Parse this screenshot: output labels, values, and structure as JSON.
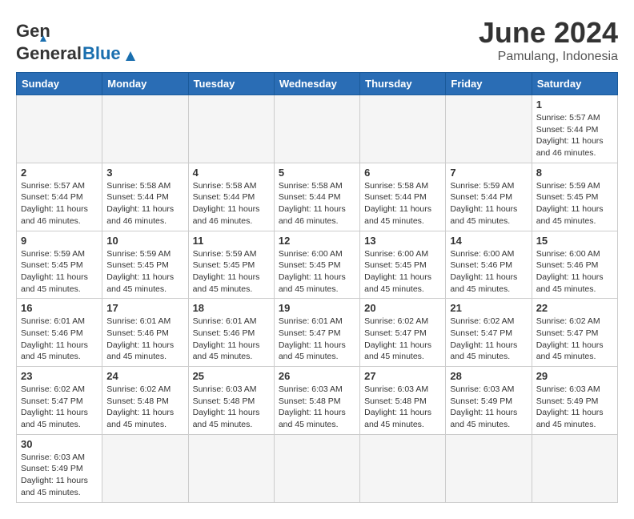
{
  "header": {
    "logo_general": "General",
    "logo_blue": "Blue",
    "month_year": "June 2024",
    "location": "Pamulang, Indonesia"
  },
  "weekdays": [
    "Sunday",
    "Monday",
    "Tuesday",
    "Wednesday",
    "Thursday",
    "Friday",
    "Saturday"
  ],
  "days": [
    {
      "date": "",
      "empty": true
    },
    {
      "date": "",
      "empty": true
    },
    {
      "date": "",
      "empty": true
    },
    {
      "date": "",
      "empty": true
    },
    {
      "date": "",
      "empty": true
    },
    {
      "date": "",
      "empty": true
    },
    {
      "date": "1",
      "sunrise": "5:57 AM",
      "sunset": "5:44 PM",
      "daylight": "11 hours and 46 minutes."
    },
    {
      "date": "2",
      "sunrise": "5:57 AM",
      "sunset": "5:44 PM",
      "daylight": "11 hours and 46 minutes."
    },
    {
      "date": "3",
      "sunrise": "5:58 AM",
      "sunset": "5:44 PM",
      "daylight": "11 hours and 46 minutes."
    },
    {
      "date": "4",
      "sunrise": "5:58 AM",
      "sunset": "5:44 PM",
      "daylight": "11 hours and 46 minutes."
    },
    {
      "date": "5",
      "sunrise": "5:58 AM",
      "sunset": "5:44 PM",
      "daylight": "11 hours and 46 minutes."
    },
    {
      "date": "6",
      "sunrise": "5:58 AM",
      "sunset": "5:44 PM",
      "daylight": "11 hours and 45 minutes."
    },
    {
      "date": "7",
      "sunrise": "5:59 AM",
      "sunset": "5:44 PM",
      "daylight": "11 hours and 45 minutes."
    },
    {
      "date": "8",
      "sunrise": "5:59 AM",
      "sunset": "5:45 PM",
      "daylight": "11 hours and 45 minutes."
    },
    {
      "date": "9",
      "sunrise": "5:59 AM",
      "sunset": "5:45 PM",
      "daylight": "11 hours and 45 minutes."
    },
    {
      "date": "10",
      "sunrise": "5:59 AM",
      "sunset": "5:45 PM",
      "daylight": "11 hours and 45 minutes."
    },
    {
      "date": "11",
      "sunrise": "5:59 AM",
      "sunset": "5:45 PM",
      "daylight": "11 hours and 45 minutes."
    },
    {
      "date": "12",
      "sunrise": "6:00 AM",
      "sunset": "5:45 PM",
      "daylight": "11 hours and 45 minutes."
    },
    {
      "date": "13",
      "sunrise": "6:00 AM",
      "sunset": "5:45 PM",
      "daylight": "11 hours and 45 minutes."
    },
    {
      "date": "14",
      "sunrise": "6:00 AM",
      "sunset": "5:46 PM",
      "daylight": "11 hours and 45 minutes."
    },
    {
      "date": "15",
      "sunrise": "6:00 AM",
      "sunset": "5:46 PM",
      "daylight": "11 hours and 45 minutes."
    },
    {
      "date": "16",
      "sunrise": "6:01 AM",
      "sunset": "5:46 PM",
      "daylight": "11 hours and 45 minutes."
    },
    {
      "date": "17",
      "sunrise": "6:01 AM",
      "sunset": "5:46 PM",
      "daylight": "11 hours and 45 minutes."
    },
    {
      "date": "18",
      "sunrise": "6:01 AM",
      "sunset": "5:46 PM",
      "daylight": "11 hours and 45 minutes."
    },
    {
      "date": "19",
      "sunrise": "6:01 AM",
      "sunset": "5:47 PM",
      "daylight": "11 hours and 45 minutes."
    },
    {
      "date": "20",
      "sunrise": "6:02 AM",
      "sunset": "5:47 PM",
      "daylight": "11 hours and 45 minutes."
    },
    {
      "date": "21",
      "sunrise": "6:02 AM",
      "sunset": "5:47 PM",
      "daylight": "11 hours and 45 minutes."
    },
    {
      "date": "22",
      "sunrise": "6:02 AM",
      "sunset": "5:47 PM",
      "daylight": "11 hours and 45 minutes."
    },
    {
      "date": "23",
      "sunrise": "6:02 AM",
      "sunset": "5:47 PM",
      "daylight": "11 hours and 45 minutes."
    },
    {
      "date": "24",
      "sunrise": "6:02 AM",
      "sunset": "5:48 PM",
      "daylight": "11 hours and 45 minutes."
    },
    {
      "date": "25",
      "sunrise": "6:03 AM",
      "sunset": "5:48 PM",
      "daylight": "11 hours and 45 minutes."
    },
    {
      "date": "26",
      "sunrise": "6:03 AM",
      "sunset": "5:48 PM",
      "daylight": "11 hours and 45 minutes."
    },
    {
      "date": "27",
      "sunrise": "6:03 AM",
      "sunset": "5:48 PM",
      "daylight": "11 hours and 45 minutes."
    },
    {
      "date": "28",
      "sunrise": "6:03 AM",
      "sunset": "5:49 PM",
      "daylight": "11 hours and 45 minutes."
    },
    {
      "date": "29",
      "sunrise": "6:03 AM",
      "sunset": "5:49 PM",
      "daylight": "11 hours and 45 minutes."
    },
    {
      "date": "30",
      "sunrise": "6:03 AM",
      "sunset": "5:49 PM",
      "daylight": "11 hours and 45 minutes."
    }
  ]
}
